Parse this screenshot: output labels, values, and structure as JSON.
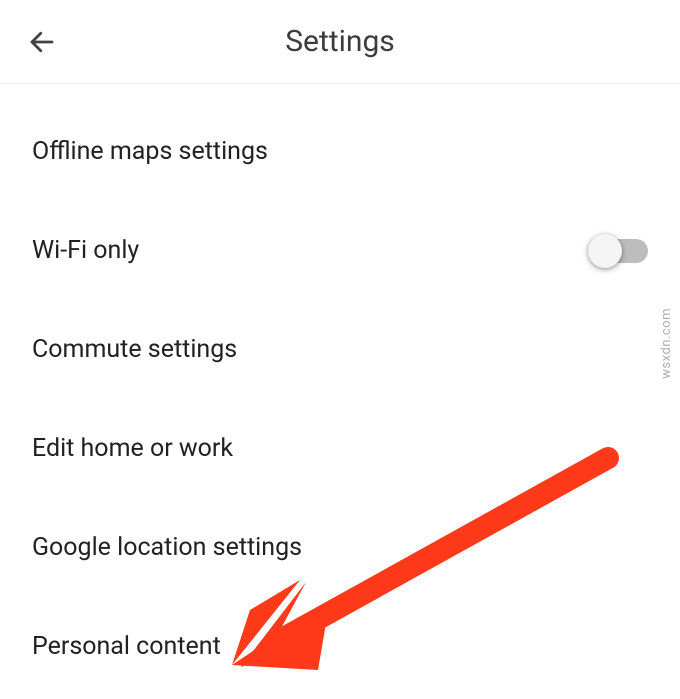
{
  "header": {
    "title": "Settings"
  },
  "items": [
    {
      "label": "Offline maps settings",
      "has_toggle": false
    },
    {
      "label": "Wi-Fi only",
      "has_toggle": true,
      "toggle_on": false
    },
    {
      "label": "Commute settings",
      "has_toggle": false
    },
    {
      "label": "Edit home or work",
      "has_toggle": false
    },
    {
      "label": "Google location settings",
      "has_toggle": false
    },
    {
      "label": "Personal content",
      "has_toggle": false
    }
  ],
  "annotation": {
    "arrow_color": "#ff3a1a"
  },
  "watermark": "wsxdn.com"
}
